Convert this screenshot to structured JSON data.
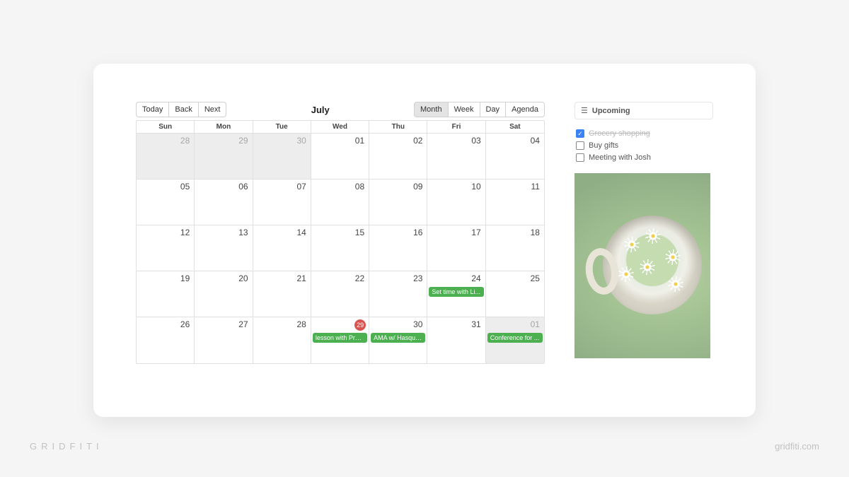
{
  "calendar": {
    "title": "July",
    "nav": {
      "today": "Today",
      "back": "Back",
      "next": "Next"
    },
    "views": {
      "month": "Month",
      "week": "Week",
      "day": "Day",
      "agenda": "Agenda",
      "active": "month"
    },
    "days": [
      "Sun",
      "Mon",
      "Tue",
      "Wed",
      "Thu",
      "Fri",
      "Sat"
    ],
    "weeks": [
      [
        {
          "n": "28",
          "off": true
        },
        {
          "n": "29",
          "off": true
        },
        {
          "n": "30",
          "off": true
        },
        {
          "n": "01"
        },
        {
          "n": "02"
        },
        {
          "n": "03"
        },
        {
          "n": "04"
        }
      ],
      [
        {
          "n": "05"
        },
        {
          "n": "06"
        },
        {
          "n": "07"
        },
        {
          "n": "08"
        },
        {
          "n": "09"
        },
        {
          "n": "10"
        },
        {
          "n": "11"
        }
      ],
      [
        {
          "n": "12"
        },
        {
          "n": "13"
        },
        {
          "n": "14"
        },
        {
          "n": "15"
        },
        {
          "n": "16"
        },
        {
          "n": "17"
        },
        {
          "n": "18"
        }
      ],
      [
        {
          "n": "19"
        },
        {
          "n": "20"
        },
        {
          "n": "21"
        },
        {
          "n": "22"
        },
        {
          "n": "23"
        },
        {
          "n": "24",
          "ev": "Set time with Li..."
        },
        {
          "n": "25"
        }
      ],
      [
        {
          "n": "26"
        },
        {
          "n": "27"
        },
        {
          "n": "28"
        },
        {
          "n": "29",
          "today": true,
          "ev": "lesson with Prof..."
        },
        {
          "n": "30",
          "ev": "AMA w/ Hasque..."
        },
        {
          "n": "31"
        },
        {
          "n": "01",
          "off": true,
          "ev": "Conference for ..."
        }
      ]
    ]
  },
  "sidebar": {
    "upcoming_label": "Upcoming",
    "todos": [
      {
        "label": "Grocery shopping",
        "checked": true
      },
      {
        "label": "Buy gifts",
        "checked": false
      },
      {
        "label": "Meeting with Josh",
        "checked": false
      }
    ],
    "image_alt": "cup with daisies"
  },
  "footer": {
    "brand": "GRIDFITI",
    "url": "gridfiti.com"
  }
}
